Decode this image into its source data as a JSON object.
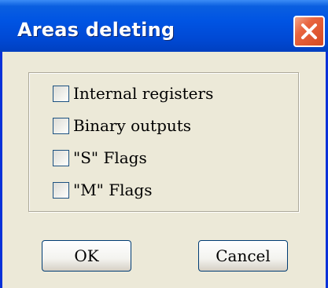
{
  "window": {
    "title": "Areas deleting",
    "close_icon": "close-icon"
  },
  "options": [
    {
      "label": "Internal registers",
      "checked": false
    },
    {
      "label": "Binary outputs",
      "checked": false
    },
    {
      "label": "\"S\" Flags",
      "checked": false
    },
    {
      "label": "\"M\" Flags",
      "checked": false
    }
  ],
  "buttons": {
    "ok_label": "OK",
    "cancel_label": "Cancel"
  },
  "colors": {
    "titlebar": "#0054e3",
    "close_button": "#d54a22",
    "dialog_background": "#ece9d8"
  }
}
